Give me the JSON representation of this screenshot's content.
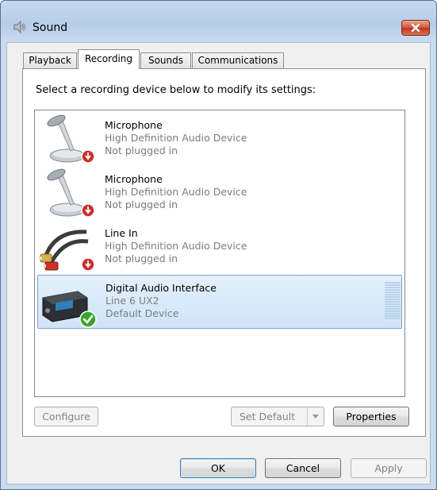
{
  "window": {
    "title": "Sound"
  },
  "tabs": [
    {
      "label": "Playback"
    },
    {
      "label": "Recording"
    },
    {
      "label": "Sounds"
    },
    {
      "label": "Communications"
    }
  ],
  "instruction": "Select a recording device below to modify its settings:",
  "devices": [
    {
      "name": "Microphone",
      "sub": "High Definition Audio Device",
      "status": "Not plugged in"
    },
    {
      "name": "Microphone",
      "sub": "High Definition Audio Device",
      "status": "Not plugged in"
    },
    {
      "name": "Line In",
      "sub": "High Definition Audio Device",
      "status": "Not plugged in"
    },
    {
      "name": "Digital Audio Interface",
      "sub": "Line 6 UX2",
      "status": "Default Device"
    }
  ],
  "buttons": {
    "configure": "Configure",
    "set_default": "Set Default",
    "properties": "Properties",
    "ok": "OK",
    "cancel": "Cancel",
    "apply": "Apply"
  }
}
